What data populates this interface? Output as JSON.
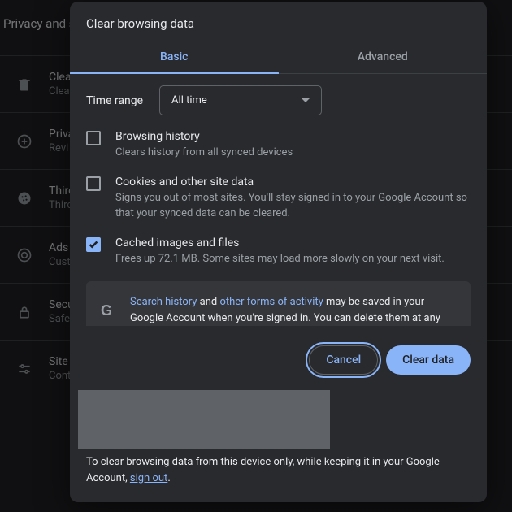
{
  "bg": {
    "section_title": "Privacy and s",
    "items": [
      {
        "title": "Clea",
        "sub": "Clea"
      },
      {
        "title": "Priva",
        "sub": "Revi"
      },
      {
        "title": "Third",
        "sub": "Thirc"
      },
      {
        "title": "Ads",
        "sub": "Cust"
      },
      {
        "title": "Secu",
        "sub": "Safe"
      },
      {
        "title": "Site",
        "sub": "Cont"
      }
    ]
  },
  "dialog": {
    "title": "Clear browsing data",
    "tabs": {
      "basic": "Basic",
      "advanced": "Advanced"
    },
    "time_range_label": "Time range",
    "time_range_value": "All time",
    "options": [
      {
        "title": "Browsing history",
        "desc": "Clears history from all synced devices",
        "checked": false
      },
      {
        "title": "Cookies and other site data",
        "desc": "Signs you out of most sites. You'll stay signed in to your Google Account so that your synced data can be cleared.",
        "checked": false
      },
      {
        "title": "Cached images and files",
        "desc": "Frees up 72.1 MB. Some sites may load more slowly on your next visit.",
        "checked": true
      }
    ],
    "info": {
      "link1": "Search history",
      "mid1": " and ",
      "link2": "other forms of activity",
      "rest": " may be saved in your Google Account when you're signed in. You can delete them at any"
    },
    "buttons": {
      "cancel": "Cancel",
      "clear": "Clear data"
    },
    "footer_pre": "To clear browsing data from this device only, while keeping it in your Google Account, ",
    "footer_link": "sign out",
    "footer_post": "."
  }
}
